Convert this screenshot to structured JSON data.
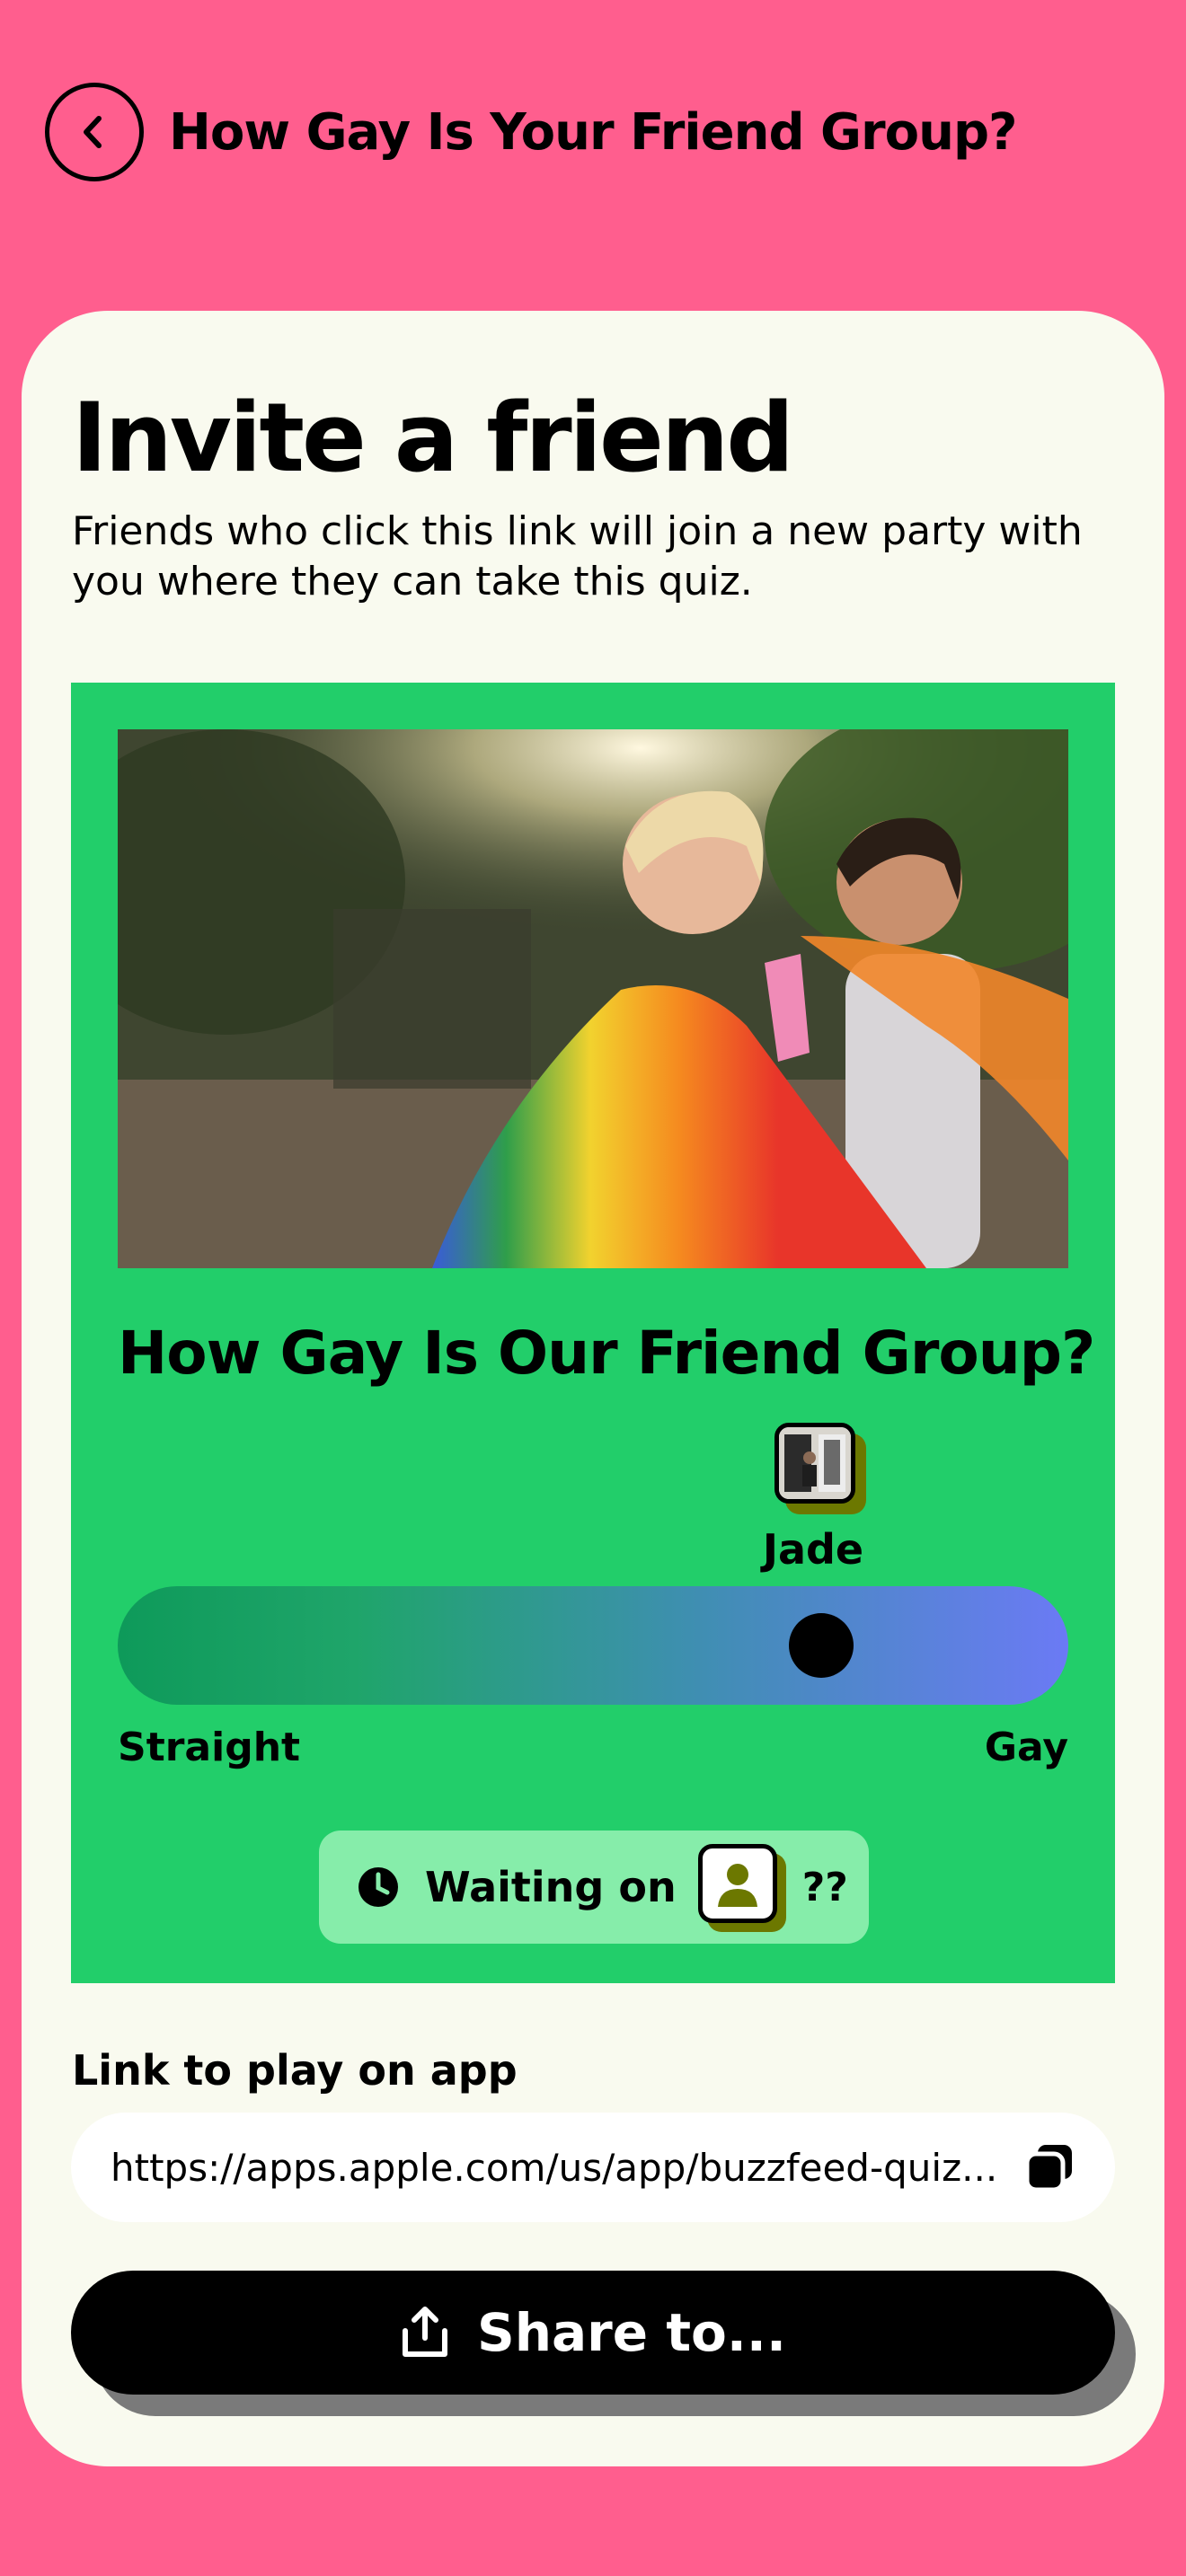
{
  "header": {
    "title": "How Gay Is Your Friend Group?",
    "back_icon": "chevron-left-icon"
  },
  "card": {
    "title": "Invite a friend",
    "subtitle": "Friends who click this link will join a new party with you where they can take this quiz."
  },
  "quiz": {
    "title": "How Gay Is Our Friend Group?",
    "participant_name": "Jade",
    "meter": {
      "left_label": "Straight",
      "right_label": "Gay",
      "value": 0.74,
      "gradient_start": "#0E9A5A",
      "gradient_end": "#6B7AF5"
    },
    "waiting": {
      "label": "Waiting on",
      "unknown": "??",
      "icon": "clock-icon"
    }
  },
  "link": {
    "label": "Link to play on app",
    "url": "https://apps.apple.com/us/app/buzzfeed-quiz...",
    "copy_icon": "copy-icon"
  },
  "share": {
    "label": "Share to...",
    "icon": "share-icon"
  },
  "colors": {
    "background": "#FF5E8E",
    "card": "#F9FAEF",
    "panel": "#22CE6A",
    "waiting_pill": "#86EDAA",
    "avatar_shadow": "#6C7800"
  }
}
